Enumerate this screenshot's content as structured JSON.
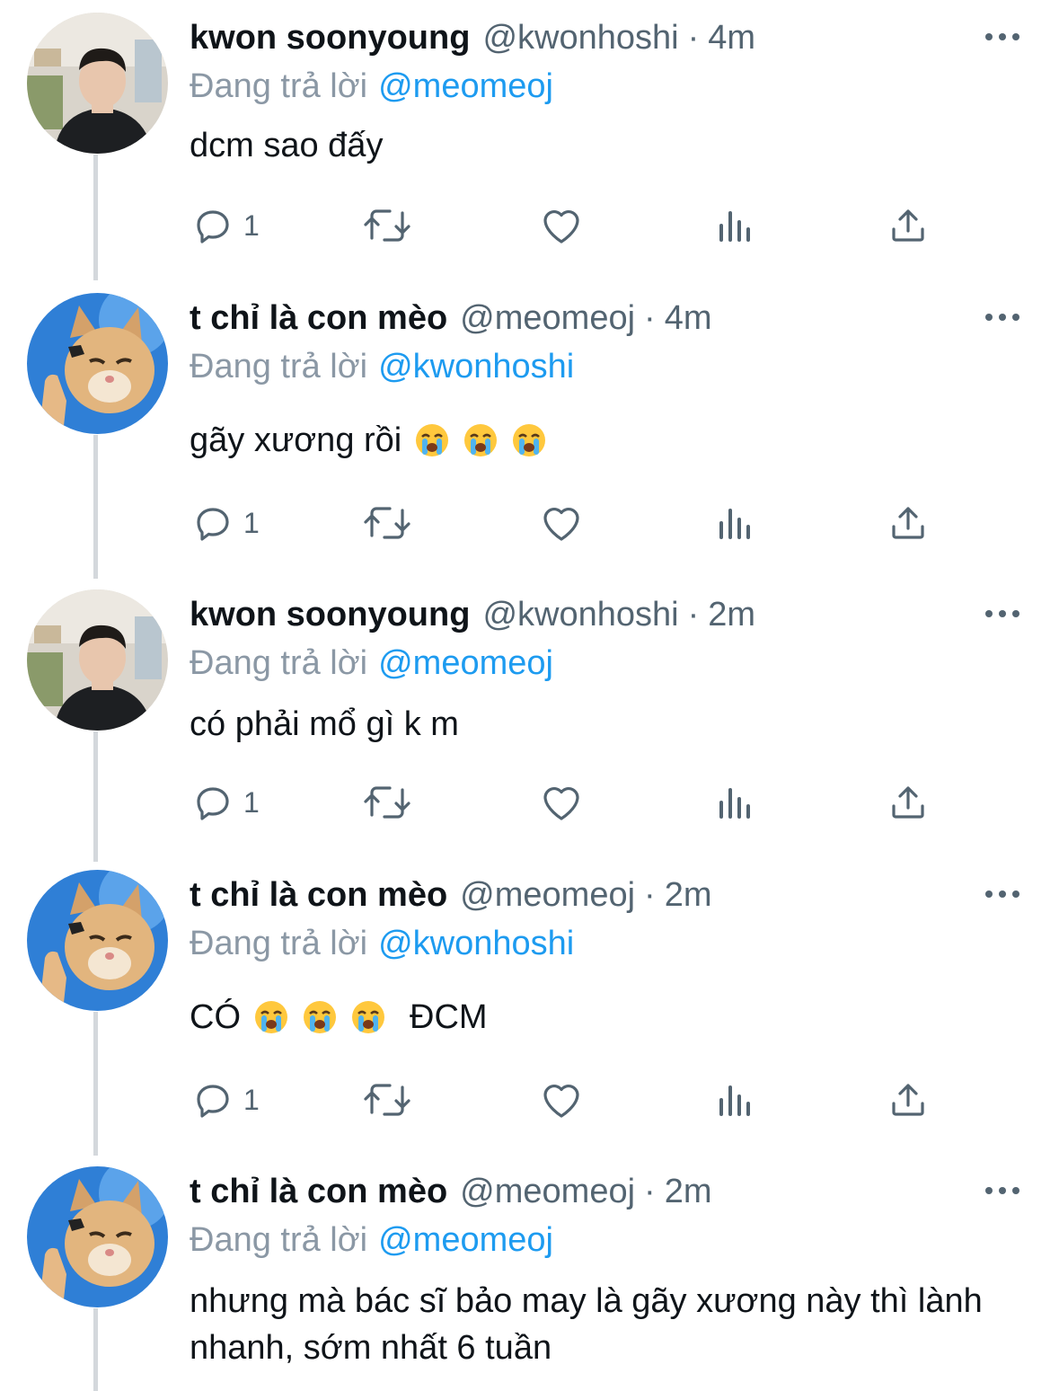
{
  "tweets": [
    {
      "avatar": "person-avatar",
      "name": "kwon soonyoung",
      "handle": "@kwonhoshi",
      "time": "4m",
      "reply_label": "Đang trả lời",
      "reply_to": "@meomeoj",
      "text": "dcm sao đấy",
      "reply_count": "1"
    },
    {
      "avatar": "cat-avatar",
      "name": "t chỉ là con mèo",
      "handle": "@meomeoj",
      "time": "4m",
      "reply_label": "Đang trả lời",
      "reply_to": "@kwonhoshi",
      "text": "gãy xương rồi",
      "emojis": [
        "loudly-crying-face",
        "loudly-crying-face",
        "loudly-crying-face"
      ],
      "reply_count": "1"
    },
    {
      "avatar": "person-avatar",
      "name": "kwon soonyoung",
      "handle": "@kwonhoshi",
      "time": "2m",
      "reply_label": "Đang trả lời",
      "reply_to": "@meomeoj",
      "text": "có phải mổ gì k m",
      "reply_count": "1"
    },
    {
      "avatar": "cat-avatar",
      "name": "t chỉ là con mèo",
      "handle": "@meomeoj",
      "time": "2m",
      "reply_label": "Đang trả lời",
      "reply_to": "@kwonhoshi",
      "text": "CÓ",
      "emojis": [
        "loudly-crying-face",
        "loudly-crying-face",
        "loudly-crying-face"
      ],
      "text_after": "ĐCM",
      "reply_count": "1"
    },
    {
      "avatar": "cat-avatar",
      "name": "t chỉ là con mèo",
      "handle": "@meomeoj",
      "time": "2m",
      "reply_label": "Đang trả lời",
      "reply_to": "@meomeoj",
      "text": "nhưng mà bác sĩ bảo may là gãy xương này thì lành nhanh, sớm nhất 6 tuần"
    }
  ],
  "dot_separator": "·",
  "icons": {
    "reply": "reply-icon",
    "retweet": "retweet-icon",
    "like": "like-icon",
    "views": "views-icon",
    "share": "share-icon",
    "more": "more-icon"
  },
  "colors": {
    "text": "#0f1419",
    "secondary": "#536471",
    "reply_label": "#8b98a5",
    "mention": "#1d9bf0",
    "thread_line": "#d4d8dc"
  }
}
